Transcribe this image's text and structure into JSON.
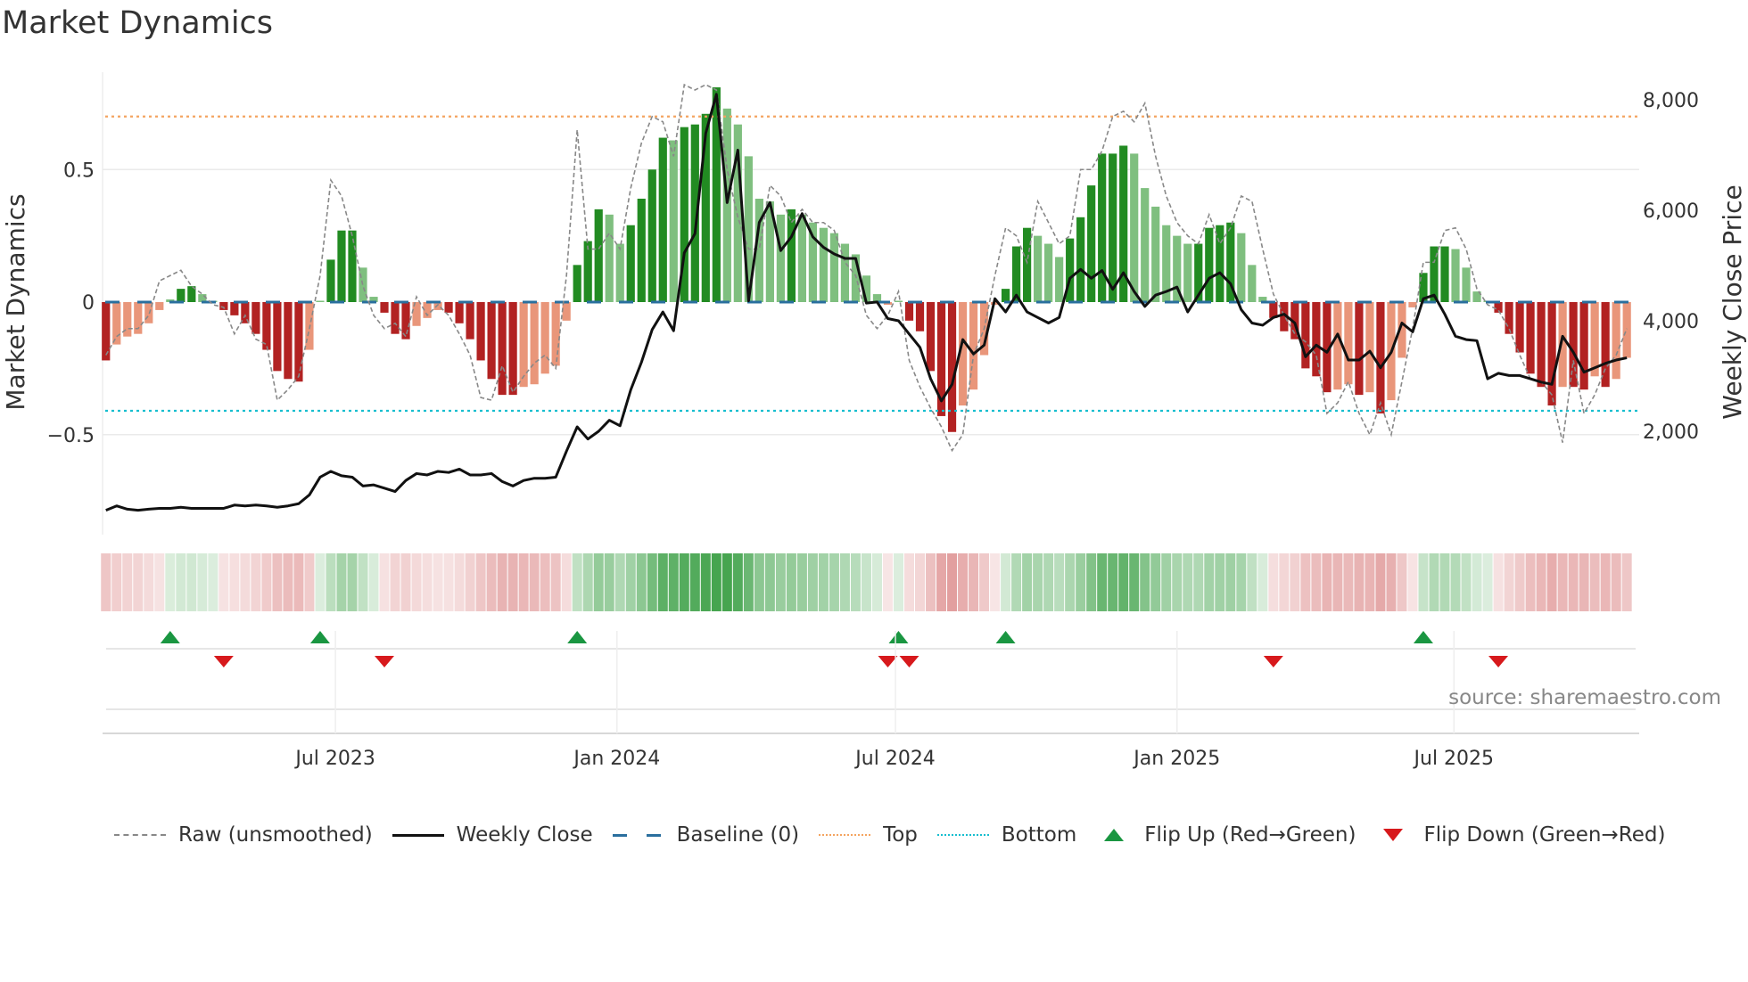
{
  "title": "Market Dynamics",
  "source": "source: sharemaestro.com",
  "colors": {
    "dark_green": "#228b22",
    "light_green": "#7fbf7f",
    "dark_red": "#b22222",
    "light_red": "#e9967a",
    "close": "#111111",
    "raw": "#888888",
    "baseline": "#2a6f9e",
    "top": "#f4a460",
    "bottom": "#17becf",
    "flip_up": "#1a9641",
    "flip_down": "#d7191c"
  },
  "chart_data": {
    "type": "bar",
    "title": "Market Dynamics",
    "ylabel": "Market Dynamics",
    "ylabel_right": "Weekly Close Price",
    "ylim": [
      -0.85,
      0.82
    ],
    "ylim_right": [
      300,
      8400
    ],
    "yticks": [
      {
        "v": 0.5,
        "label": "0.5"
      },
      {
        "v": 0,
        "label": "0"
      },
      {
        "v": -0.5,
        "label": "−0.5"
      }
    ],
    "yticks_right": [
      {
        "v": 8000,
        "label": "8,000"
      },
      {
        "v": 6000,
        "label": "6,000"
      },
      {
        "v": 4000,
        "label": "4,000"
      },
      {
        "v": 2000,
        "label": "2,000"
      }
    ],
    "x_start": "2023-02-01",
    "x_step_days": 7,
    "xticks": [
      {
        "date": "2023-07-01",
        "label": "Jul 2023"
      },
      {
        "date": "2024-01-01",
        "label": "Jan 2024"
      },
      {
        "date": "2024-07-01",
        "label": "Jul 2024"
      },
      {
        "date": "2025-01-01",
        "label": "Jan 2025"
      },
      {
        "date": "2025-07-01",
        "label": "Jul 2025"
      }
    ],
    "top_threshold": 0.7,
    "bottom_threshold": -0.41,
    "baseline": 0,
    "dynamics": [
      -0.22,
      -0.16,
      -0.13,
      -0.12,
      -0.08,
      -0.03,
      0.01,
      0.05,
      0.06,
      0.03,
      0.005,
      -0.03,
      -0.05,
      -0.08,
      -0.12,
      -0.18,
      -0.26,
      -0.29,
      -0.3,
      -0.18,
      0.005,
      0.16,
      0.27,
      0.27,
      0.13,
      0.02,
      -0.04,
      -0.12,
      -0.14,
      -0.09,
      -0.06,
      -0.03,
      -0.04,
      -0.08,
      -0.14,
      -0.22,
      -0.29,
      -0.35,
      -0.35,
      -0.32,
      -0.31,
      -0.27,
      -0.24,
      -0.07,
      0.14,
      0.23,
      0.35,
      0.33,
      0.22,
      0.29,
      0.39,
      0.5,
      0.62,
      0.61,
      0.66,
      0.67,
      0.71,
      0.81,
      0.73,
      0.67,
      0.55,
      0.39,
      0.38,
      0.33,
      0.35,
      0.33,
      0.3,
      0.28,
      0.26,
      0.22,
      0.18,
      0.1,
      0.03,
      -0.01,
      0.005,
      -0.07,
      -0.11,
      -0.26,
      -0.43,
      -0.49,
      -0.39,
      -0.33,
      -0.2,
      -0.01,
      0.05,
      0.21,
      0.28,
      0.25,
      0.22,
      0.17,
      0.24,
      0.32,
      0.44,
      0.56,
      0.56,
      0.59,
      0.56,
      0.43,
      0.36,
      0.29,
      0.25,
      0.22,
      0.22,
      0.28,
      0.29,
      0.3,
      0.26,
      0.14,
      0.02,
      -0.06,
      -0.11,
      -0.14,
      -0.25,
      -0.28,
      -0.34,
      -0.33,
      -0.31,
      -0.35,
      -0.34,
      -0.42,
      -0.37,
      -0.21,
      -0.02,
      0.11,
      0.21,
      0.21,
      0.2,
      0.13,
      0.04,
      0.005,
      -0.04,
      -0.12,
      -0.19,
      -0.27,
      -0.32,
      -0.39,
      -0.32,
      -0.32,
      -0.33,
      -0.28,
      -0.32,
      -0.29,
      -0.21
    ],
    "raw": [
      -0.2,
      -0.13,
      -0.1,
      -0.1,
      -0.05,
      0.08,
      0.1,
      0.12,
      0.06,
      0.03,
      -0.01,
      -0.02,
      -0.12,
      -0.05,
      -0.14,
      -0.16,
      -0.37,
      -0.33,
      -0.28,
      -0.1,
      0.1,
      0.46,
      0.4,
      0.25,
      0.06,
      -0.05,
      -0.1,
      -0.08,
      -0.13,
      0.02,
      -0.05,
      -0.01,
      -0.05,
      -0.12,
      -0.2,
      -0.36,
      -0.37,
      -0.24,
      -0.34,
      -0.28,
      -0.23,
      -0.2,
      -0.25,
      0.1,
      0.65,
      0.2,
      0.2,
      0.26,
      0.2,
      0.43,
      0.6,
      0.7,
      0.68,
      0.55,
      0.82,
      0.8,
      0.82,
      0.8,
      0.5,
      0.32,
      0.2,
      0.2,
      0.44,
      0.4,
      0.3,
      0.35,
      0.3,
      0.3,
      0.27,
      0.15,
      0.1,
      -0.05,
      -0.1,
      -0.05,
      0.04,
      -0.22,
      -0.32,
      -0.4,
      -0.47,
      -0.56,
      -0.5,
      -0.2,
      -0.1,
      0.1,
      0.28,
      0.25,
      0.15,
      0.38,
      0.3,
      0.22,
      0.25,
      0.5,
      0.5,
      0.57,
      0.7,
      0.72,
      0.68,
      0.75,
      0.55,
      0.4,
      0.3,
      0.25,
      0.22,
      0.33,
      0.22,
      0.28,
      0.4,
      0.38,
      0.2,
      0.03,
      -0.05,
      -0.12,
      -0.15,
      -0.2,
      -0.42,
      -0.38,
      -0.3,
      -0.42,
      -0.5,
      -0.38,
      -0.5,
      -0.3,
      -0.1,
      0.15,
      0.15,
      0.27,
      0.28,
      0.2,
      0.05,
      -0.01,
      -0.03,
      -0.1,
      -0.2,
      -0.29,
      -0.3,
      -0.35,
      -0.53,
      -0.22,
      -0.42,
      -0.35,
      -0.25,
      -0.2,
      -0.1
    ],
    "close": [
      570,
      650,
      590,
      570,
      590,
      605,
      605,
      625,
      605,
      605,
      605,
      605,
      665,
      650,
      665,
      650,
      625,
      650,
      690,
      850,
      1170,
      1275,
      1195,
      1170,
      1010,
      1030,
      970,
      910,
      1110,
      1235,
      1210,
      1275,
      1255,
      1315,
      1210,
      1210,
      1235,
      1090,
      1010,
      1110,
      1150,
      1150,
      1170,
      1640,
      2080,
      1860,
      2000,
      2200,
      2100,
      2750,
      3250,
      3840,
      4160,
      3820,
      5230,
      5580,
      7395,
      8100,
      6140,
      7090,
      4360,
      5780,
      6140,
      5270,
      5520,
      5940,
      5520,
      5330,
      5210,
      5130,
      5130,
      4320,
      4340,
      4040,
      4000,
      3760,
      3520,
      2950,
      2550,
      2850,
      3660,
      3400,
      3560,
      4400,
      4160,
      4465,
      4160,
      4060,
      3960,
      4060,
      4770,
      4930,
      4770,
      4910,
      4570,
      4870,
      4530,
      4260,
      4465,
      4530,
      4610,
      4160,
      4465,
      4770,
      4870,
      4670,
      4200,
      3960,
      3920,
      4060,
      4120,
      3960,
      3350,
      3560,
      3430,
      3760,
      3290,
      3290,
      3450,
      3150,
      3430,
      3960,
      3800,
      4400,
      4465,
      4120,
      3720,
      3660,
      3640,
      2950,
      3050,
      3010,
      3010,
      2950,
      2890,
      2850,
      3720,
      3430,
      3070,
      3150,
      3230,
      3290,
      3330
    ]
  },
  "legend": {
    "raw": "Raw (unsmoothed)",
    "close": "Weekly Close",
    "baseline": "Baseline (0)",
    "top": "Top",
    "bottom": "Bottom",
    "flip_up": "Flip Up (Red→Green)",
    "flip_down": "Flip Down (Green→Red)"
  }
}
